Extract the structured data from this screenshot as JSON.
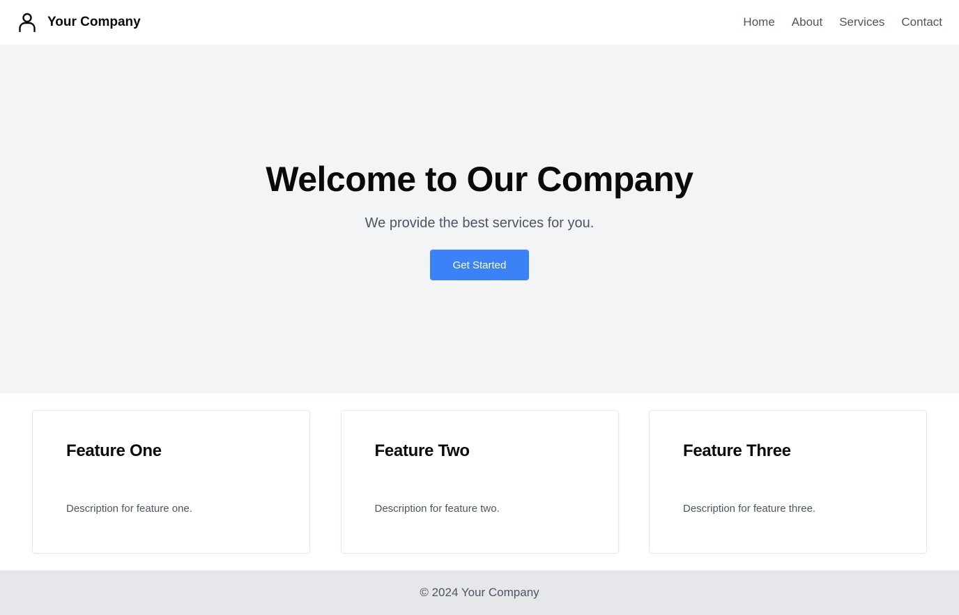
{
  "header": {
    "brand_icon": "user-icon",
    "brand_name": "Your Company",
    "nav": [
      {
        "label": "Home"
      },
      {
        "label": "About"
      },
      {
        "label": "Services"
      },
      {
        "label": "Contact"
      }
    ]
  },
  "hero": {
    "title": "Welcome to Our Company",
    "subtitle": "We provide the best services for you.",
    "cta_label": "Get Started",
    "background": "#f3f4f6",
    "cta_color": "#3b82f6"
  },
  "features": [
    {
      "title": "Feature One",
      "description": "Description for feature one."
    },
    {
      "title": "Feature Two",
      "description": "Description for feature two."
    },
    {
      "title": "Feature Three",
      "description": "Description for feature three."
    }
  ],
  "footer": {
    "text": "© 2024 Your Company",
    "background": "#e5e7eb"
  }
}
